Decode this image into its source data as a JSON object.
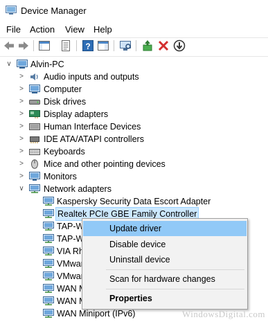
{
  "window": {
    "title": "Device Manager"
  },
  "menu": [
    "File",
    "Action",
    "View",
    "Help"
  ],
  "toolbar": {
    "buttons": [
      "back-arrow-icon",
      "forward-arrow-icon",
      "show-hide-tree-icon",
      "properties-icon",
      "help-icon",
      "action-pane-icon",
      "scan-hardware-icon",
      "update-driver-icon",
      "uninstall-icon",
      "enable-device-icon"
    ]
  },
  "tree": {
    "root": "Alvin-PC",
    "categories": [
      "Audio inputs and outputs",
      "Computer",
      "Disk drives",
      "Display adapters",
      "Human Interface Devices",
      "IDE ATA/ATAPI controllers",
      "Keyboards",
      "Mice and other pointing devices",
      "Monitors",
      "Network adapters"
    ],
    "network_children": [
      "Kaspersky Security Data Escort Adapter",
      "Realtek PCIe GBE Family Controller",
      "TAP-Wi",
      "TAP-Wi",
      "VIA Rhi",
      "VMware",
      "VMware",
      "WAN M",
      "WAN M",
      "WAN Miniport (IPv6)"
    ]
  },
  "context_menu": {
    "items": [
      "Update driver",
      "Disable device",
      "Uninstall device",
      "Scan for hardware changes",
      "Properties"
    ]
  },
  "watermark": "WindowsDigital.com",
  "colors": {
    "selection": "#cce8ff",
    "menu_highlight": "#91c9f7",
    "red_x": "#d32f2f"
  }
}
